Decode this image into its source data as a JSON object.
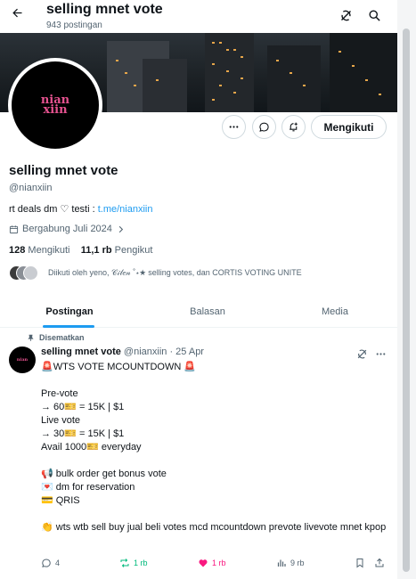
{
  "header": {
    "title": "selling mnet vote",
    "post_count": "943 postingan"
  },
  "profile": {
    "avatar_text_top": "nian",
    "avatar_text_bottom": "xiin",
    "follow_state_label": "Mengikuti",
    "name": "selling mnet vote",
    "handle": "@nianxiin",
    "bio_text": "rt deals dm ♡ testi : ",
    "bio_link": "t.me/nianxiin",
    "joined": "Bergabung Juli 2024",
    "following_count": "128",
    "following_label": "Mengikuti",
    "followers_count": "11,1 rb",
    "followers_label": "Pengikut",
    "followed_by": "Diikuti oleh yeno, 𝒞𝒾𝓁𝑒𝓃 ˚⋆★ selling votes, dan CORTIS VOTING UNITE"
  },
  "tabs": [
    {
      "label": "Postingan",
      "active": true
    },
    {
      "label": "Balasan",
      "active": false
    },
    {
      "label": "Media",
      "active": false
    }
  ],
  "pinned_label": "Disematkan",
  "tweet": {
    "name": "selling mnet vote",
    "handle_date": "@nianxiin · 25 Apr",
    "lines": [
      "🚨WTS VOTE MCOUNTDOWN 🚨",
      "",
      "Pre-vote",
      "→ 60🎫 = 15K | $1",
      "Live vote",
      "→ 30🎫 = 15K | $1",
      "Avail 1000🎫 everyday",
      "",
      "📢 bulk order get bonus vote",
      "💌 dm for reservation",
      "💳 QRIS",
      "",
      "👏 wts wtb sell buy jual beli votes mcd mcountdown prevote livevote mnet kpop"
    ],
    "replies": "4",
    "reposts": "1 rb",
    "likes": "1 rb",
    "views": "9 rb"
  },
  "colors": {
    "accent": "#1d9bf0",
    "repost": "#00ba7c",
    "like": "#f91880",
    "muted": "#536471",
    "avatar_logo": "#e5528f"
  }
}
